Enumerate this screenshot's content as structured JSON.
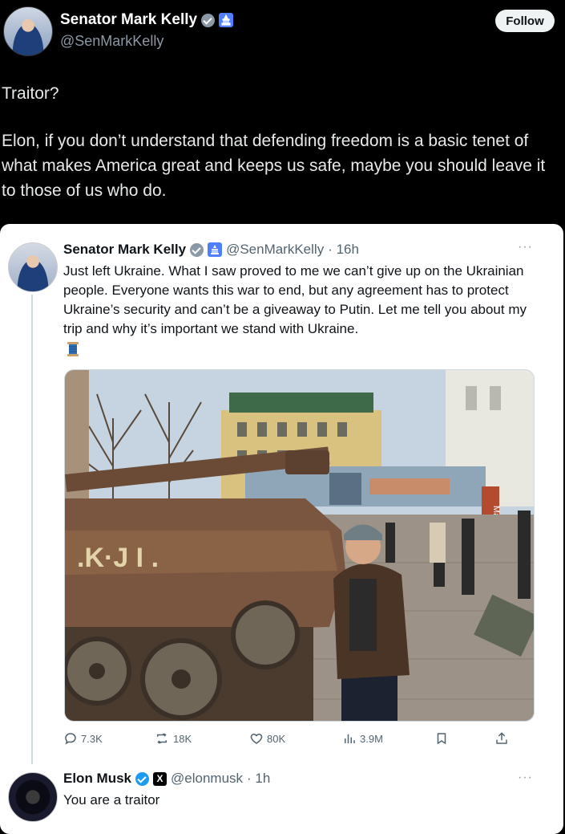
{
  "header": {
    "name": "Senator Mark Kelly",
    "handle": "@SenMarkKelly",
    "follow_label": "Follow"
  },
  "tweet": {
    "line1": "Traitor?",
    "line2": "Elon, if you don’t understand that defending freedom is a basic tenet of what makes America great and keeps us safe, maybe you should leave it to those of us who do."
  },
  "quoted": {
    "name": "Senator Mark Kelly",
    "handle": "@SenMarkKelly",
    "time": "· 16h",
    "more": "···",
    "text": "Just left Ukraine. What I saw proved to me we can’t give up on the Ukrainian people. Everyone wants this war to end, but any agreement has to protect Ukraine’s security and can’t be a giveaway to Putin. Let me tell you about my trip and why it’s important we stand with Ukraine.",
    "photo_sign": "Mariupol",
    "actions": {
      "replies": "7.3K",
      "reposts": "18K",
      "likes": "80K",
      "views": "3.9M"
    }
  },
  "reply": {
    "name": "Elon Musk",
    "handle": "@elonmusk",
    "time": "· 1h",
    "more": "···",
    "text": "You are a traitor",
    "x_badge": "X"
  },
  "icons": {
    "verified": "gray-check-icon",
    "government": "capitol-icon",
    "reply": "reply-icon",
    "repost": "repost-icon",
    "like": "heart-icon",
    "views": "views-icon",
    "bookmark": "bookmark-icon",
    "share": "share-icon"
  },
  "colors": {
    "background": "#000000",
    "card": "#ffffff",
    "secondary_text": "#536471",
    "verified_blue": "#1d9bf0",
    "gov_badge": "#4f7fff"
  }
}
